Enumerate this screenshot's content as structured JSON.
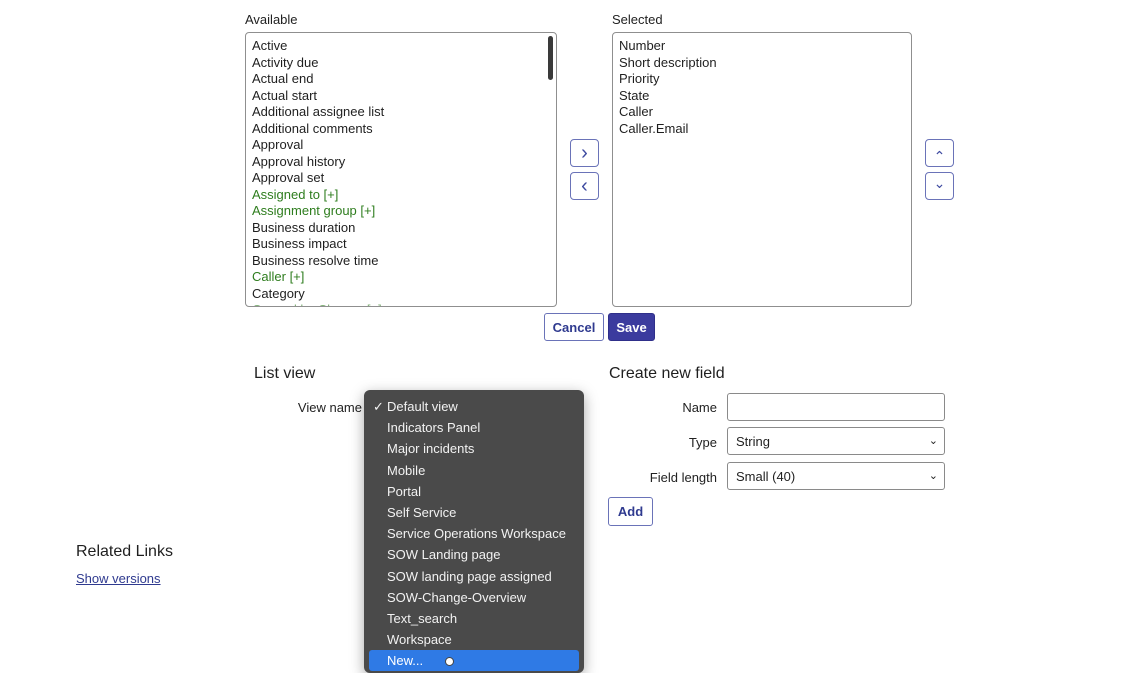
{
  "slushbucket": {
    "available_label": "Available",
    "selected_label": "Selected",
    "available_items": [
      {
        "label": "Active",
        "kind": "plain"
      },
      {
        "label": "Activity due",
        "kind": "plain"
      },
      {
        "label": "Actual end",
        "kind": "plain"
      },
      {
        "label": "Actual start",
        "kind": "plain"
      },
      {
        "label": "Additional assignee list",
        "kind": "plain"
      },
      {
        "label": "Additional comments",
        "kind": "plain"
      },
      {
        "label": "Approval",
        "kind": "plain"
      },
      {
        "label": "Approval history",
        "kind": "plain"
      },
      {
        "label": "Approval set",
        "kind": "plain"
      },
      {
        "label": "Assigned to [+]",
        "kind": "reference"
      },
      {
        "label": "Assignment group [+]",
        "kind": "reference"
      },
      {
        "label": "Business duration",
        "kind": "plain"
      },
      {
        "label": "Business impact",
        "kind": "plain"
      },
      {
        "label": "Business resolve time",
        "kind": "plain"
      },
      {
        "label": "Caller [+]",
        "kind": "reference"
      },
      {
        "label": "Category",
        "kind": "plain"
      },
      {
        "label": "Caused by Change [+]",
        "kind": "cut"
      }
    ],
    "selected_items": [
      "Number",
      "Short description",
      "Priority",
      "State",
      "Caller",
      "Caller.Email"
    ],
    "add_arrow": "›",
    "remove_arrow": "‹",
    "move_up_arrow": "⌃",
    "move_down_arrow": "⌄",
    "cancel_label": "Cancel",
    "save_label": "Save"
  },
  "list_view": {
    "title": "List view",
    "view_name_label": "View name",
    "dropdown": {
      "options": [
        {
          "label": "Default view",
          "checked": true,
          "highlighted": false
        },
        {
          "label": "Indicators Panel",
          "checked": false,
          "highlighted": false
        },
        {
          "label": "Major incidents",
          "checked": false,
          "highlighted": false
        },
        {
          "label": "Mobile",
          "checked": false,
          "highlighted": false
        },
        {
          "label": "Portal",
          "checked": false,
          "highlighted": false
        },
        {
          "label": "Self Service",
          "checked": false,
          "highlighted": false
        },
        {
          "label": "Service Operations Workspace",
          "checked": false,
          "highlighted": false
        },
        {
          "label": "SOW Landing page",
          "checked": false,
          "highlighted": false
        },
        {
          "label": "SOW landing page assigned",
          "checked": false,
          "highlighted": false
        },
        {
          "label": "SOW-Change-Overview",
          "checked": false,
          "highlighted": false
        },
        {
          "label": "Text_search",
          "checked": false,
          "highlighted": false
        },
        {
          "label": "Workspace",
          "checked": false,
          "highlighted": false
        },
        {
          "label": "New...",
          "checked": false,
          "highlighted": true
        }
      ],
      "check_glyph": "✓"
    }
  },
  "create_field": {
    "title": "Create new field",
    "name_label": "Name",
    "name_value": "",
    "type_label": "Type",
    "type_value": "String",
    "length_label": "Field length",
    "length_value": "Small (40)",
    "add_label": "Add",
    "select_chevron": "⌄"
  },
  "related_links": {
    "title": "Related Links",
    "show_versions": "Show versions"
  },
  "colors": {
    "reference_field": "#2e7d1e",
    "primary": "#3b3b9e",
    "menu_bg": "#4a4a4a",
    "menu_highlight": "#2f7ae5"
  }
}
